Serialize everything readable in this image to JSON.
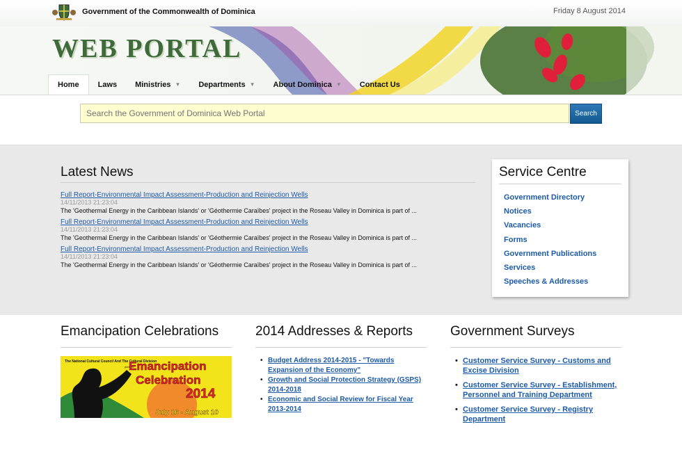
{
  "header": {
    "gov_name": "Government of the Commonwealth of Dominica",
    "date": "Friday 8 August 2014",
    "logo_text": "WEB PORTAL"
  },
  "nav": {
    "items": [
      {
        "label": "Home",
        "active": true,
        "dropdown": false
      },
      {
        "label": "Laws",
        "active": false,
        "dropdown": false
      },
      {
        "label": "Ministries",
        "active": false,
        "dropdown": true
      },
      {
        "label": "Departments",
        "active": false,
        "dropdown": true
      },
      {
        "label": "About Dominica",
        "active": false,
        "dropdown": true
      },
      {
        "label": "Contact Us",
        "active": false,
        "dropdown": false
      }
    ]
  },
  "search": {
    "placeholder": "Search the Government of Dominica Web Portal",
    "button_label": "Search"
  },
  "news": {
    "title": "Latest News",
    "items": [
      {
        "link": "Full Report-Environmental Impact Assessment-Production and Reinjection Wells",
        "date": "14/11/2013 21:23:04",
        "summary": "The 'Geothermal Energy in the Caribbean Islands' or 'Géothermie Caraïbes' project in the Roseau Valley in Dominica is part of ..."
      },
      {
        "link": "Full Report-Environmental Impact Assessment-Production and Reinjection Wells",
        "date": "14/11/2013 21:23:04",
        "summary": "The 'Geothermal Energy in the Caribbean Islands' or 'Géothermie Caraïbes' project in the Roseau Valley in Dominica is part of ..."
      },
      {
        "link": "Full Report-Environmental Impact Assessment-Production and Reinjection Wells",
        "date": "14/11/2013 21:23:04",
        "summary": "The 'Geothermal Energy in the Caribbean Islands' or 'Géothermie Caraïbes' project in the Roseau Valley in Dominica is part of ..."
      }
    ]
  },
  "service_centre": {
    "title": "Service Centre",
    "items": [
      "Government Directory",
      "Notices",
      "Vacancies",
      "Forms",
      "Government Publications",
      "Services",
      "Speeches & Addresses"
    ]
  },
  "emancipation": {
    "title": "Emancipation Celebrations",
    "image_text": {
      "org": "The National Cultural Council And The Cultural Division",
      "presents": "present",
      "line1": "Emancipation",
      "line2": "Celebration",
      "year": "2014",
      "dates": "July 16 - August 10"
    }
  },
  "addresses": {
    "title": "2014 Addresses & Reports",
    "items": [
      "Budget Address 2014-2015 - \"Towards Expansion of the Economy\"",
      "Growth and Social Protection Strategy (GSPS) 2014-2018",
      "Economic and Social Review for Fiscal Year 2013-2014"
    ]
  },
  "surveys": {
    "title": "Government Surveys",
    "items": [
      "Customer Service Survey - Customs and Excise Division",
      "Customer Service Survey - Establishment, Personnel and Training Department",
      "Customer Service Survey - Registry Department"
    ]
  },
  "colors": {
    "link": "#1d5aa7",
    "search_bg": "#fdfdd0",
    "search_button": "#1a6aa6",
    "band_bg": "#e9e9e9"
  }
}
